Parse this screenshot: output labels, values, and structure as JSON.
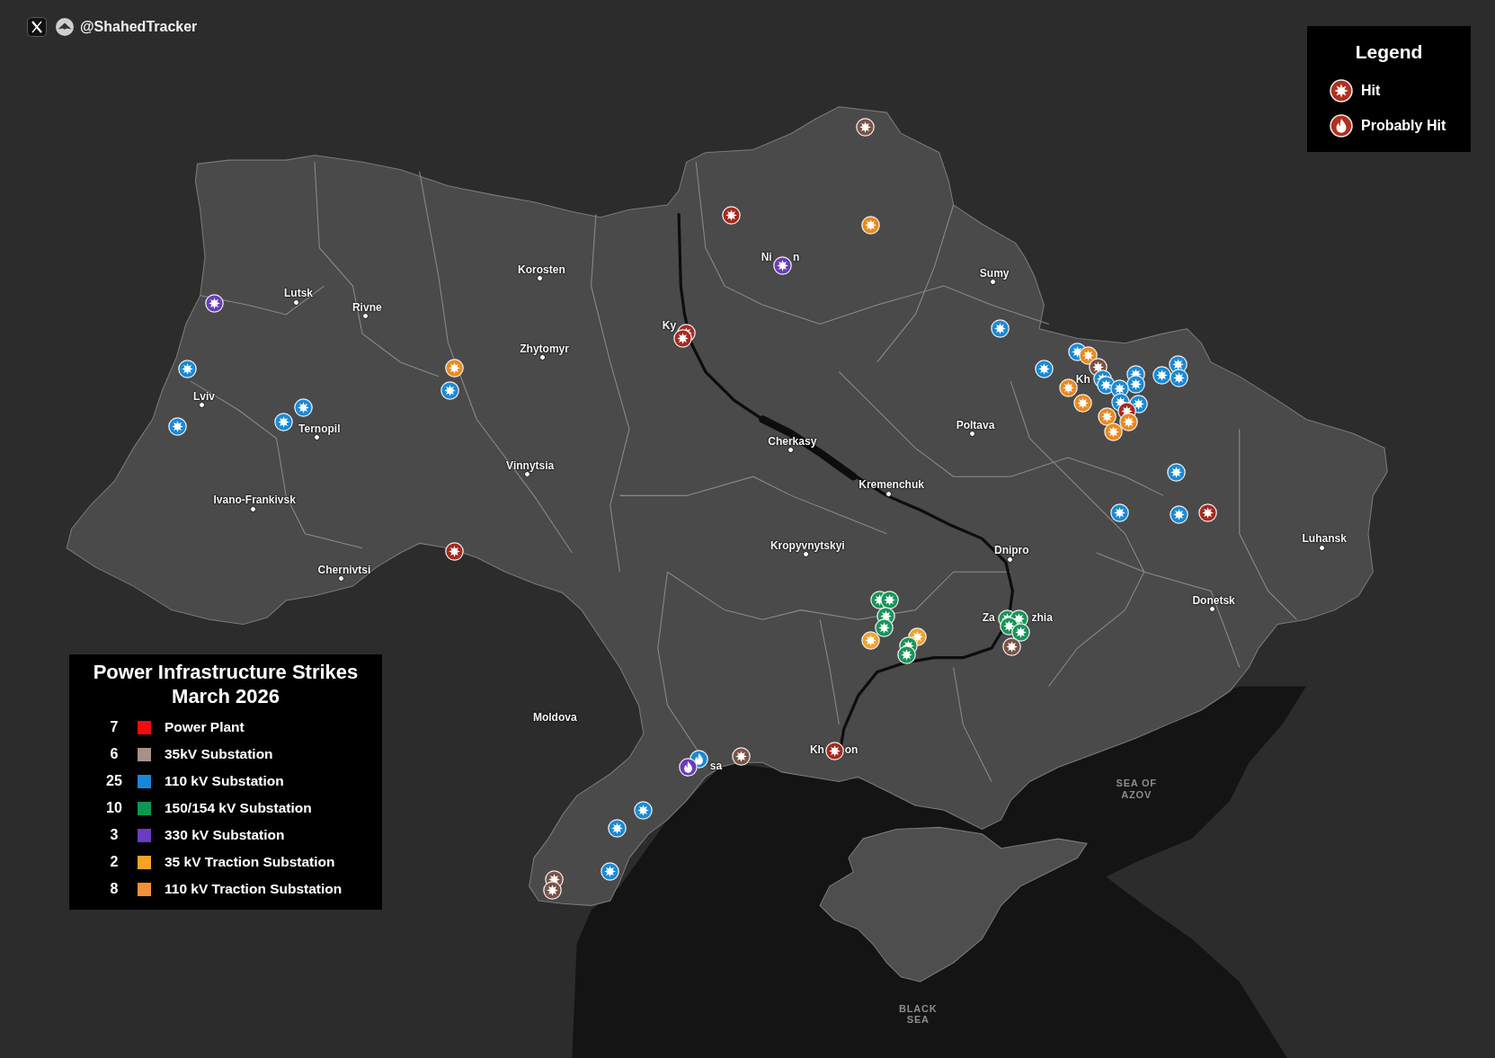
{
  "credit": {
    "handle": "@ShahedTracker"
  },
  "legend": {
    "title": "Legend",
    "items": [
      {
        "kind": "hit",
        "label": "Hit"
      },
      {
        "kind": "probable",
        "label": "Probably Hit"
      }
    ]
  },
  "summary": {
    "title": "Power Infrastructure Strikes",
    "subtitle": "March 2026",
    "rows": [
      {
        "count": "7",
        "color": "#f20c0c",
        "label": "Power Plant"
      },
      {
        "count": "6",
        "color": "#a8918a",
        "label": "35kV Substation"
      },
      {
        "count": "25",
        "color": "#1888dc",
        "label": "110 kV Substation"
      },
      {
        "count": "10",
        "color": "#0f9650",
        "label": "150/154 kV Substation"
      },
      {
        "count": "3",
        "color": "#6a3cbf",
        "label": "330 kV Substation"
      },
      {
        "count": "2",
        "color": "#f5a425",
        "label": "35 kV Traction Substation"
      },
      {
        "count": "8",
        "color": "#f28f3b",
        "label": "110 kV Traction Substation"
      }
    ]
  },
  "map": {
    "place_labels": [
      {
        "name": "Ni",
        "kind": "label"
      },
      {
        "name": "n",
        "kind": "label"
      },
      {
        "name": "Korosten",
        "kind": "city"
      },
      {
        "name": "Sumy",
        "kind": "city"
      },
      {
        "name": "Lutsk",
        "kind": "city"
      },
      {
        "name": "Rivne",
        "kind": "city"
      },
      {
        "name": "Ky",
        "kind": "label"
      },
      {
        "name": "Zhytomyr",
        "kind": "city"
      },
      {
        "name": "Kh",
        "kind": "label"
      },
      {
        "name": "Lviv",
        "kind": "city"
      },
      {
        "name": "Poltava",
        "kind": "city"
      },
      {
        "name": "Ternopil",
        "kind": "city"
      },
      {
        "name": "Cherkasy",
        "kind": "city"
      },
      {
        "name": "Vinnytsia",
        "kind": "city"
      },
      {
        "name": "Kremenchuk",
        "kind": "city"
      },
      {
        "name": "Ivano-Frankivsk",
        "kind": "city"
      },
      {
        "name": "Luhansk",
        "kind": "city"
      },
      {
        "name": "Kropyvnytskyi",
        "kind": "city"
      },
      {
        "name": "Dnipro",
        "kind": "city"
      },
      {
        "name": "Chernivtsi",
        "kind": "city"
      },
      {
        "name": "Donetsk",
        "kind": "city"
      },
      {
        "name": "Za",
        "kind": "label"
      },
      {
        "name": "zhia",
        "kind": "label"
      },
      {
        "name": "Moldova",
        "kind": "label"
      },
      {
        "name": "Kh",
        "kind": "label"
      },
      {
        "name": "on",
        "kind": "label"
      },
      {
        "name": "sa",
        "kind": "label"
      }
    ],
    "sea_labels": [
      {
        "name": "SEA OF AZOV"
      },
      {
        "name": "BLACK SEA"
      }
    ],
    "markers": [
      {
        "color": "#7a5346",
        "kind": "hit"
      },
      {
        "color": "#a52a1e",
        "kind": "hit"
      },
      {
        "color": "#ea8a1f",
        "kind": "hit"
      },
      {
        "color": "#6b3db8",
        "kind": "hit"
      },
      {
        "color": "#6b3db8",
        "kind": "hit"
      },
      {
        "color": "#1a8ad6",
        "kind": "hit"
      },
      {
        "color": "#a52a1e",
        "kind": "hit"
      },
      {
        "color": "#a52a1e",
        "kind": "hit"
      },
      {
        "color": "#1a8ad6",
        "kind": "hit"
      },
      {
        "color": "#ea8a1f",
        "kind": "hit"
      },
      {
        "color": "#1a8ad6",
        "kind": "hit"
      },
      {
        "color": "#7a5346",
        "kind": "hit"
      },
      {
        "color": "#ea8a1f",
        "kind": "hit"
      },
      {
        "color": "#1a8ad6",
        "kind": "hit"
      },
      {
        "color": "#1a8ad6",
        "kind": "hit"
      },
      {
        "color": "#1a8ad6",
        "kind": "hit"
      },
      {
        "color": "#1a8ad6",
        "kind": "hit"
      },
      {
        "color": "#1a8ad6",
        "kind": "hit"
      },
      {
        "color": "#1a8ad6",
        "kind": "hit"
      },
      {
        "color": "#1a8ad6",
        "kind": "hit"
      },
      {
        "color": "#1a8ad6",
        "kind": "hit"
      },
      {
        "color": "#ea8a1f",
        "kind": "hit"
      },
      {
        "color": "#1a8ad6",
        "kind": "hit"
      },
      {
        "color": "#1a8ad6",
        "kind": "hit"
      },
      {
        "color": "#ea8a1f",
        "kind": "hit"
      },
      {
        "color": "#1a8ad6",
        "kind": "hit"
      },
      {
        "color": "#1a8ad6",
        "kind": "hit"
      },
      {
        "color": "#1a8ad6",
        "kind": "hit"
      },
      {
        "color": "#a52a1e",
        "kind": "hit"
      },
      {
        "color": "#ea8a1f",
        "kind": "hit"
      },
      {
        "color": "#1a8ad6",
        "kind": "hit"
      },
      {
        "color": "#ea8a1f",
        "kind": "hit"
      },
      {
        "color": "#1a8ad6",
        "kind": "hit"
      },
      {
        "color": "#ea8a1f",
        "kind": "hit"
      },
      {
        "color": "#1a8ad6",
        "kind": "hit"
      },
      {
        "color": "#1a8ad6",
        "kind": "hit"
      },
      {
        "color": "#1a8ad6",
        "kind": "hit"
      },
      {
        "color": "#a52a1e",
        "kind": "hit"
      },
      {
        "color": "#a52a1e",
        "kind": "hit"
      },
      {
        "color": "#19955a",
        "kind": "hit"
      },
      {
        "color": "#19955a",
        "kind": "hit"
      },
      {
        "color": "#19955a",
        "kind": "hit"
      },
      {
        "color": "#19955a",
        "kind": "hit"
      },
      {
        "color": "#19955a",
        "kind": "hit"
      },
      {
        "color": "#19955a",
        "kind": "hit"
      },
      {
        "color": "#19955a",
        "kind": "hit"
      },
      {
        "color": "#19955a",
        "kind": "hit"
      },
      {
        "color": "#f0a32a",
        "kind": "hit"
      },
      {
        "color": "#f0a32a",
        "kind": "hit"
      },
      {
        "color": "#19955a",
        "kind": "hit"
      },
      {
        "color": "#7a5346",
        "kind": "hit"
      },
      {
        "color": "#19955a",
        "kind": "hit"
      },
      {
        "color": "#a52a1e",
        "kind": "hit"
      },
      {
        "color": "#7a5346",
        "kind": "hit"
      },
      {
        "color": "#1a8ad6",
        "kind": "probable"
      },
      {
        "color": "#6b3db8",
        "kind": "probable"
      },
      {
        "color": "#1a8ad6",
        "kind": "hit"
      },
      {
        "color": "#1a8ad6",
        "kind": "hit"
      },
      {
        "color": "#1a8ad6",
        "kind": "hit"
      },
      {
        "color": "#7a5346",
        "kind": "hit"
      },
      {
        "color": "#7a5346",
        "kind": "hit"
      }
    ]
  }
}
